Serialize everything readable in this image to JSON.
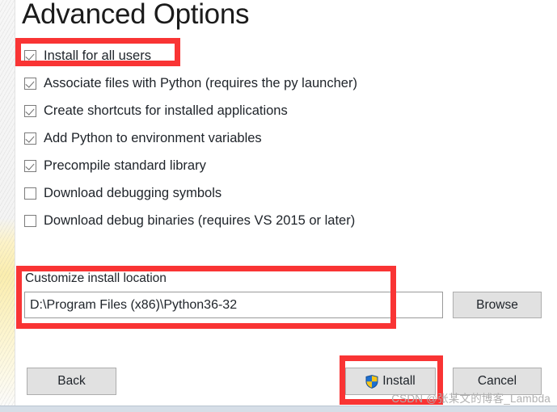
{
  "window": {
    "title": "Advanced Options"
  },
  "options": [
    {
      "label": "Install for all users",
      "checked": true
    },
    {
      "label": "Associate files with Python (requires the py launcher)",
      "checked": true
    },
    {
      "label": "Create shortcuts for installed applications",
      "checked": true
    },
    {
      "label": "Add Python to environment variables",
      "checked": true
    },
    {
      "label": "Precompile standard library",
      "checked": true
    },
    {
      "label": "Download debugging symbols",
      "checked": false
    },
    {
      "label": "Download debug binaries (requires VS 2015 or later)",
      "checked": false
    }
  ],
  "install_location": {
    "label": "Customize install location",
    "value": "D:\\Program Files (x86)\\Python36-32",
    "placeholder": "",
    "browse_label": "Browse"
  },
  "footer": {
    "back_label": "Back",
    "install_label": "Install",
    "cancel_label": "Cancel"
  },
  "watermark": {
    "text": "CSDN @张某文的博客_Lambda"
  },
  "colors": {
    "annotation_red": "#f93434",
    "button_face": "#e1e1e1",
    "button_border": "#adadad",
    "text": "#20252b",
    "shield_blue": "#1d6fd0",
    "shield_yellow": "#f5c518"
  }
}
